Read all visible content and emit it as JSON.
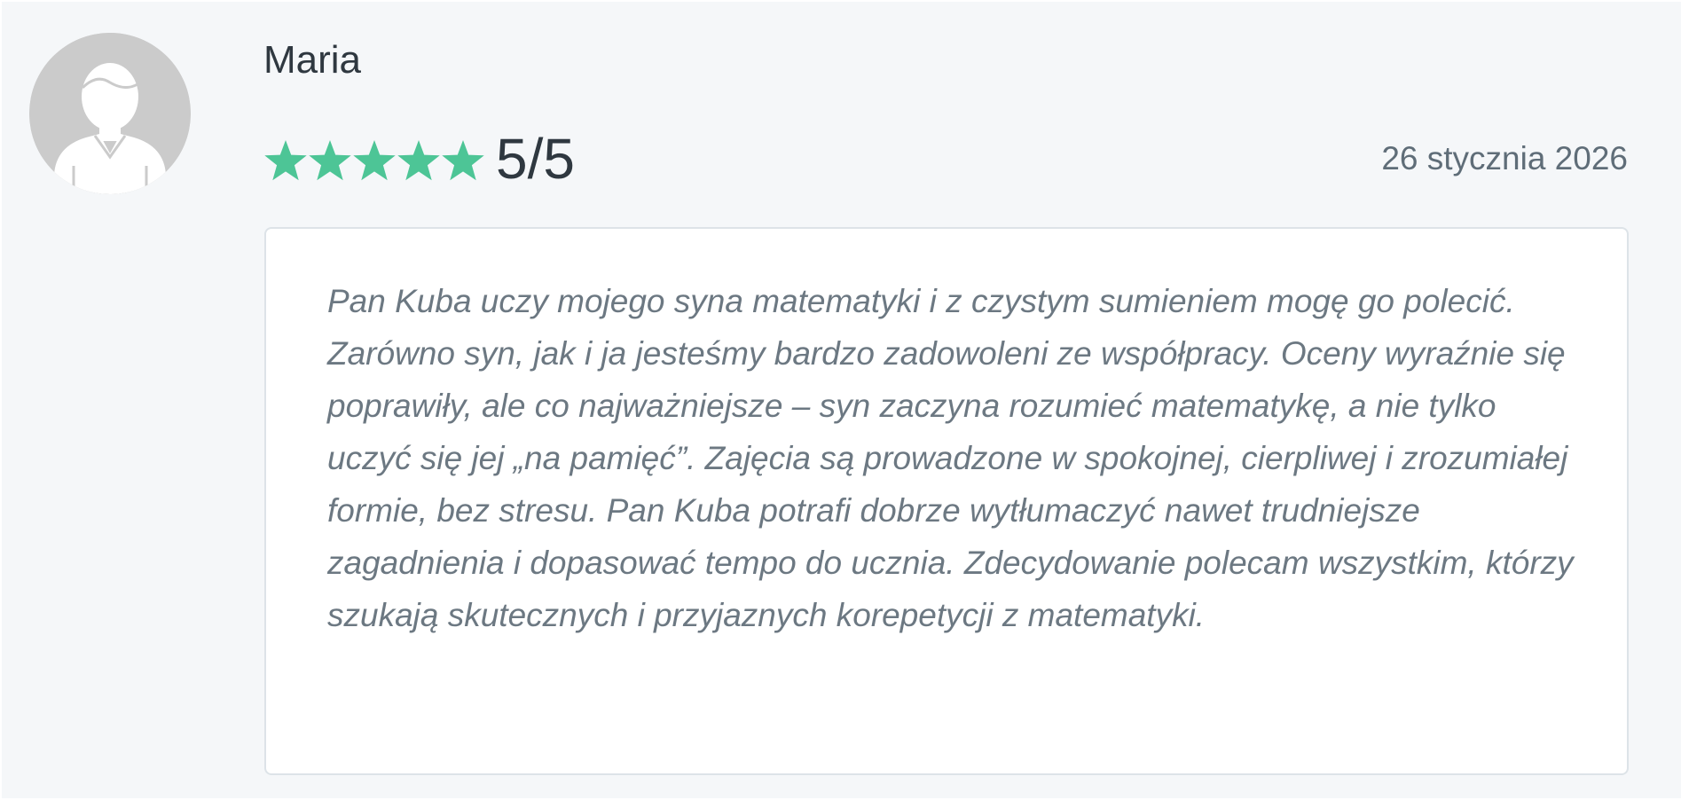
{
  "review": {
    "author": "Maria",
    "rating_value": 5,
    "rating_max": 5,
    "rating_text": "5/5",
    "date": "26 stycznia 2026",
    "text": "Pan Kuba uczy mojego syna matematyki i z czystym sumieniem mogę go polecić. Zarówno syn, jak i ja jesteśmy bardzo zadowoleni ze współpracy. Oceny wyraźnie się poprawiły, ale co najważniejsze – syn zaczyna rozumieć matematykę, a nie tylko uczyć się jej „na pamięć”. Zajęcia są prowadzone w spokojnej, cierpliwej i zrozumiałej formie, bez stresu. Pan Kuba potrafi dobrze wytłumaczyć nawet trudniejsze zagadnienia i dopasować tempo do ucznia. Zdecydowanie polecam wszystkim, którzy szukają skutecznych i przyjaznych korepetycji z matematyki."
  },
  "icons": {
    "avatar": "user-avatar-icon",
    "star": "star-icon"
  },
  "colors": {
    "star": "#4dc596",
    "avatar_bg": "#cbcbcb",
    "avatar_fg": "#ffffff",
    "page_bg": "#f5f7f9",
    "text_dark": "#2f3840",
    "text_muted": "#6c7882"
  }
}
